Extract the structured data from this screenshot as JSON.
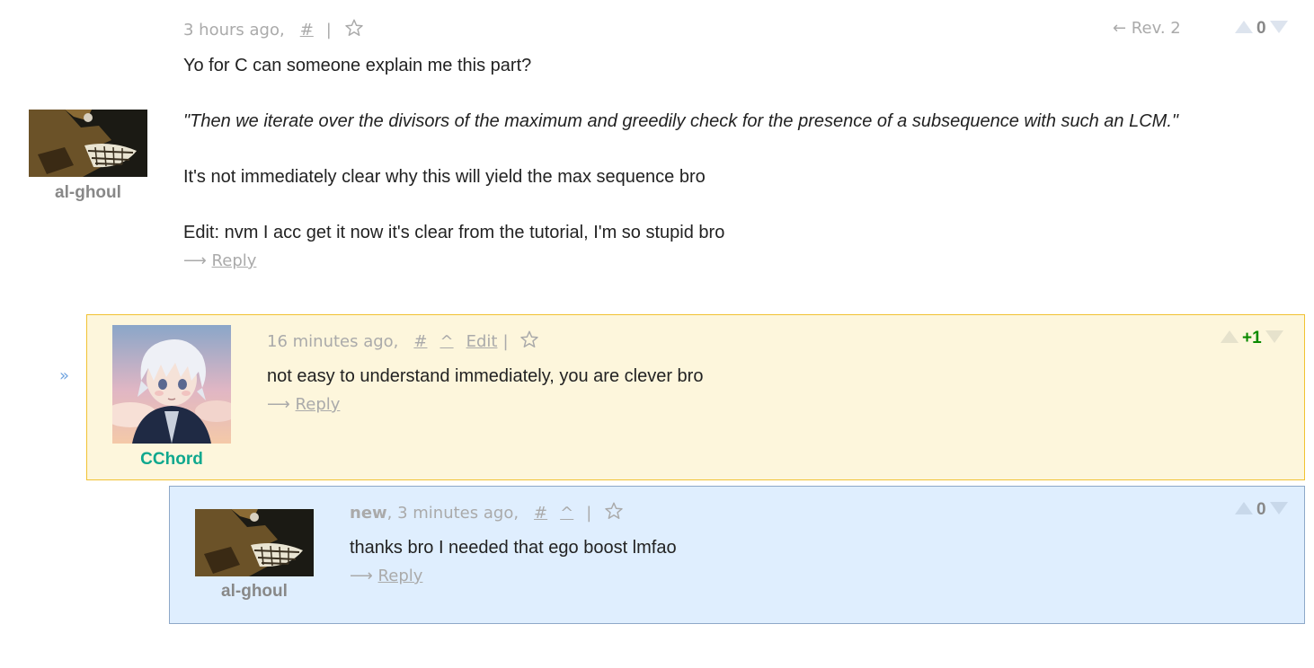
{
  "comments": [
    {
      "username": "al-ghoul",
      "username_color": "#888888",
      "time": "3 hours ago,",
      "hash": "#",
      "sep": "|",
      "revision": "← Rev. 2",
      "votes": "0",
      "votes_color": "#888888",
      "lines": [
        "Yo for C can someone explain me this part?",
        "\"Then we iterate over the divisors of the maximum and greedily check for the presence of a subsequence with such an LCM.\"",
        "It's not immediately clear why this will yield the max sequence bro",
        "Edit: nvm I acc get it now it's clear from the tutorial, I'm so stupid bro"
      ],
      "reply_arrow": "⟶",
      "reply_label": "Reply"
    },
    {
      "username": "CChord",
      "username_color": "#0fa88e",
      "time": "16 minutes ago,",
      "hash": "#",
      "caret": "^",
      "edit": "Edit",
      "sep": "|",
      "votes": "+1",
      "votes_color": "#0a8a00",
      "lines": [
        "not easy to understand immediately, you are clever bro"
      ],
      "reply_arrow": "⟶",
      "reply_label": "Reply",
      "collapse_icon": "»"
    },
    {
      "username": "al-ghoul",
      "username_color": "#888888",
      "new_label": "new",
      "time": ", 3 minutes ago,",
      "hash": "#",
      "caret": "^",
      "sep": "|",
      "votes": "0",
      "votes_color": "#888888",
      "lines": [
        "thanks bro I needed that ego boost lmfao"
      ],
      "reply_arrow": "⟶",
      "reply_label": "Reply"
    }
  ],
  "icons": {
    "star": "star-icon",
    "upvote": "upvote-icon",
    "downvote": "downvote-icon",
    "collapse": "collapse-icon"
  },
  "colors": {
    "highlight_bg": "#fdf6dc",
    "highlight_border": "#f1c232",
    "new_bg": "#dfeefe",
    "new_border": "#8ea8c8",
    "meta_gray": "#aaaaaa"
  }
}
